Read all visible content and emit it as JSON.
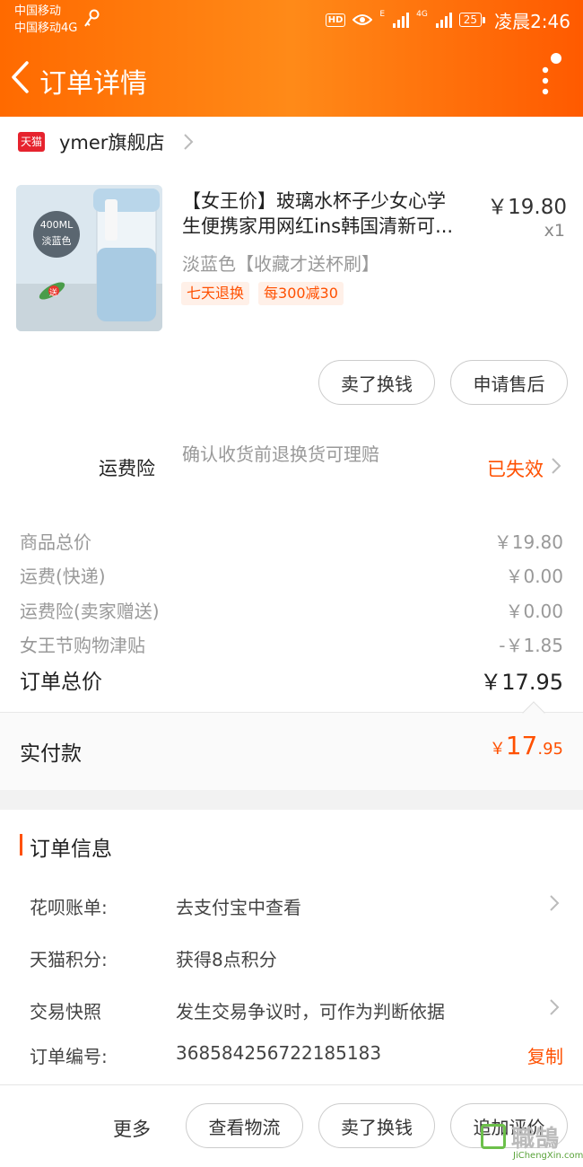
{
  "status_bar": {
    "carrier1": "中国移动",
    "carrier2": "中国移动4G",
    "hd": "HD",
    "net1": "E",
    "net2": "4G",
    "battery": "25",
    "time": "凌晨2:46"
  },
  "header": {
    "title": "订单详情",
    "back_icon": "chevron-left-icon",
    "menu_icon": "more-vertical-icon",
    "color": "#ff6a00"
  },
  "store": {
    "badge": "天猫",
    "name": "ymer旗舰店"
  },
  "product": {
    "title_line1": "【女王价】玻璃水杯子少女心学",
    "title_line2": "生便携家用网红ins韩国清新可...",
    "price": "￥19.80",
    "qty": "x1",
    "sku": "淡蓝色【收藏才送杯刷】",
    "image_badge_top": "400ML",
    "image_badge_bottom": "淡蓝色",
    "image_gift": "送",
    "tags": [
      "七天退换",
      "每300减30"
    ]
  },
  "product_actions": {
    "sell": "卖了换钱",
    "after_sale": "申请售后"
  },
  "insurance": {
    "label": "运费险",
    "desc": "确认收货前退换货可理赔",
    "status": "已失效"
  },
  "summary": {
    "rows": [
      {
        "label": "商品总价",
        "value": "￥19.80"
      },
      {
        "label": "运费(快递)",
        "value": "￥0.00"
      },
      {
        "label": "运费险(卖家赠送)",
        "value": "￥0.00"
      },
      {
        "label": "女王节购物津贴",
        "value": "-￥1.85"
      }
    ],
    "total_label": "订单总价",
    "total_value": "￥17.95"
  },
  "paid": {
    "label": "实付款",
    "currency": "￥",
    "int": "17",
    "dec": ".95"
  },
  "order_info": {
    "title": "订单信息",
    "rows": [
      {
        "key": "花呗账单:",
        "value": "去支付宝中查看"
      },
      {
        "key": "天猫积分:",
        "value": "获得8点积分"
      },
      {
        "key": "交易快照",
        "value": "发生交易争议时，可作为判断依据"
      },
      {
        "key": "订单编号:",
        "value": "368584256722185183"
      }
    ],
    "copy": "复制"
  },
  "bottom": {
    "more": "更多",
    "logistics": "查看物流",
    "sell": "卖了换钱",
    "review": "追加评价"
  },
  "watermark": {
    "text": "職鵠",
    "sub": "JiChengXin.com"
  },
  "colors": {
    "accent": "#ff5000",
    "tmall": "#e6232e"
  }
}
